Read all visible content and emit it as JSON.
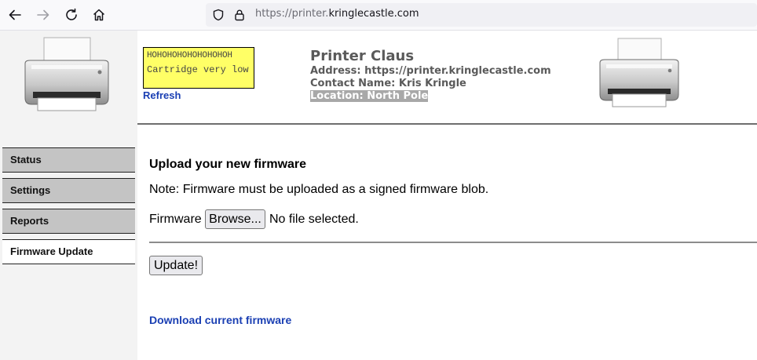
{
  "browser": {
    "url_scheme": "https://",
    "url_host": "printer.",
    "url_domain": "kringlecastle.com"
  },
  "sidebar": {
    "items": [
      {
        "label": "Status"
      },
      {
        "label": "Settings"
      },
      {
        "label": "Reports"
      },
      {
        "label": "Firmware Update",
        "active": true
      }
    ]
  },
  "status_box": {
    "line1": "HOHOHOHOHOHOHOHOH",
    "line2": "Cartridge very low"
  },
  "refresh_label": "Refresh",
  "printer_info": {
    "name": "Printer Claus",
    "address": "Address: https://printer.kringlecastle.com",
    "contact": "Contact Name: Kris Kringle",
    "location": "Location: North Pole"
  },
  "main": {
    "heading": "Upload your new firmware",
    "note": "Note: Firmware must be uploaded as a signed firmware blob.",
    "firmware_label": "Firmware",
    "browse_label": "Browse...",
    "file_status": "No file selected.",
    "update_label": "Update!",
    "download_label": "Download current firmware"
  },
  "colors": {
    "link": "#1a3fb3",
    "status_box_bg": "#ffff66",
    "nav_bg": "#c4c4c4"
  }
}
